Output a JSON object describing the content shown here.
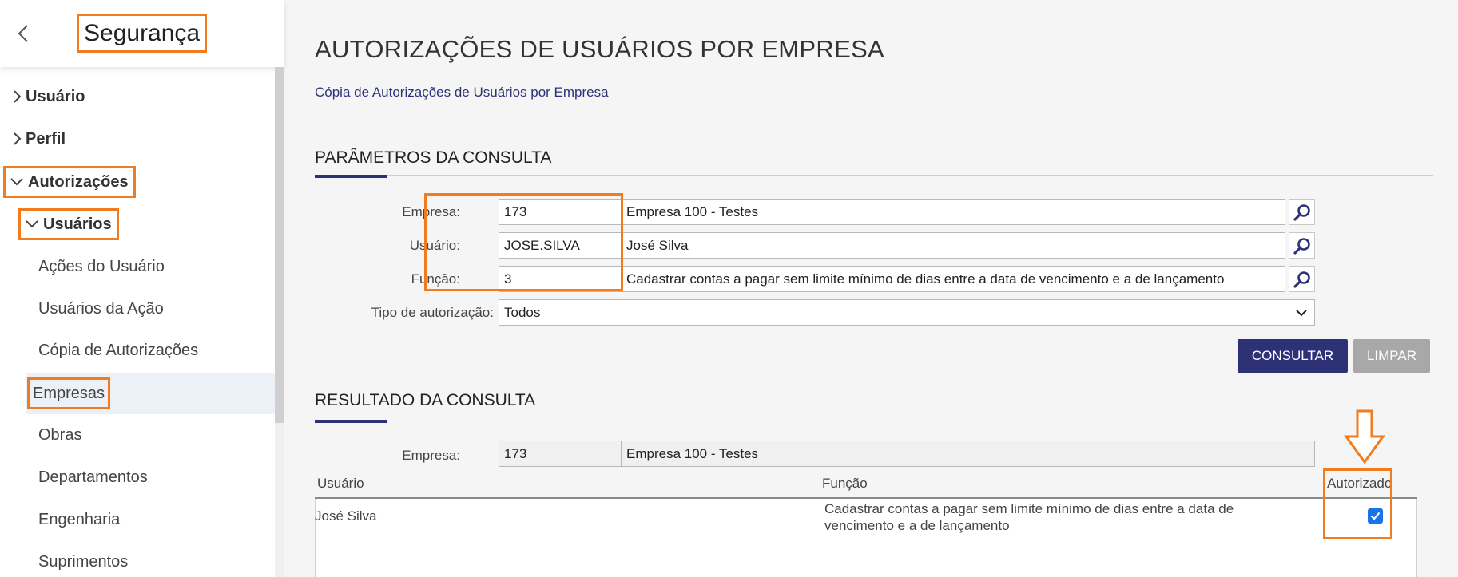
{
  "sidebar": {
    "title": "Segurança",
    "items": [
      {
        "label": "Usuário"
      },
      {
        "label": "Perfil"
      },
      {
        "label": "Autorizações"
      },
      {
        "label": "Usuários"
      }
    ],
    "sub_items": [
      {
        "label": "Ações do Usuário"
      },
      {
        "label": "Usuários da Ação"
      },
      {
        "label": "Cópia de Autorizações"
      },
      {
        "label": "Empresas"
      },
      {
        "label": "Obras"
      },
      {
        "label": "Departamentos"
      },
      {
        "label": "Engenharia"
      },
      {
        "label": "Suprimentos"
      }
    ],
    "selected": "Empresas"
  },
  "main": {
    "page_title": "AUTORIZAÇÕES DE USUÁRIOS POR EMPRESA",
    "copy_link": "Cópia de Autorizações de Usuários por Empresa",
    "params": {
      "section_title": "PARÂMETROS DA CONSULTA",
      "empresa_label": "Empresa:",
      "empresa_code": "173",
      "empresa_name": "Empresa 100 - Testes",
      "usuario_label": "Usuário:",
      "usuario_code": "JOSE.SILVA",
      "usuario_name": "José Silva",
      "funcao_label": "Função:",
      "funcao_code": "3",
      "funcao_name": "Cadastrar contas a pagar sem limite mínimo de dias entre a data de vencimento e a de lançamento",
      "tipo_label": "Tipo de autorização:",
      "tipo_value": "Todos",
      "consultar_label": "CONSULTAR",
      "limpar_label": "LIMPAR"
    },
    "result": {
      "section_title": "RESULTADO DA CONSULTA",
      "empresa_label": "Empresa:",
      "empresa_code": "173",
      "empresa_name": "Empresa 100 - Testes",
      "columns": [
        "Usuário",
        "Função",
        "Autorizado"
      ],
      "rows": [
        {
          "usuario": "José Silva",
          "funcao": "Cadastrar contas a pagar sem limite mínimo de dias entre a data de vencimento e a de lançamento",
          "autorizado": true
        }
      ]
    }
  },
  "colors": {
    "accent": "#2d3277",
    "highlight": "#f07c1f",
    "checkbox": "#1a73e8",
    "disabled_button": "#a8a8a8"
  }
}
